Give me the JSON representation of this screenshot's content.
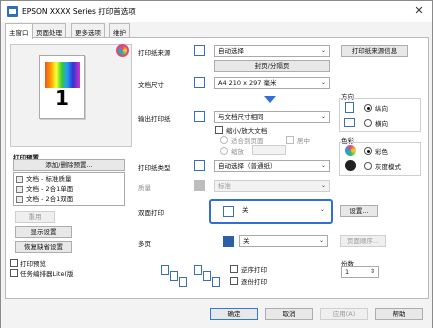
{
  "window": {
    "title": "EPSON XXXX Series 打印首选项",
    "close_glyph": "✕"
  },
  "tabs": [
    {
      "label": "主窗口",
      "active": true
    },
    {
      "label": "页面处理"
    },
    {
      "label": "更多选项"
    },
    {
      "label": "维护"
    }
  ],
  "preview": {
    "page_number": "1"
  },
  "presets": {
    "title": "打印预置",
    "add_remove_label": "添加/删除预置...",
    "items": [
      {
        "label": "文档 - 标准质量"
      },
      {
        "label": "文档 - 2合1单面"
      },
      {
        "label": "文档 - 2合1双面"
      }
    ],
    "show_settings_label": "显示设置",
    "reset_label": "恢复缺省设置",
    "apply_label": "重用",
    "print_preview_label": "打印预览",
    "job_arranger_label": "任务编排器Lite(版"
  },
  "settings": {
    "paper_source_label": "打印纸来源",
    "paper_source_value": "自动选择",
    "paper_source_info_label": "打印纸来源信息",
    "envelope_label": "封页/分隔页",
    "doc_size_label": "文档尺寸",
    "doc_size_value": "A4 210 x 297 毫米",
    "output_paper_label": "输出打印纸",
    "output_paper_value": "与文档尺寸相同",
    "reduce_enlarge_label": "缩小/放大文档",
    "fit_to_page_label": "适合到页面",
    "center_label": "居中",
    "zoom_label": "缩放",
    "paper_type_label": "打印纸类型",
    "paper_type_value": "自动选择（普通纸）",
    "quality_label": "质量",
    "quality_value": "标准",
    "duplex_label": "双面打印",
    "duplex_value": "关",
    "duplex_settings_label": "设置...",
    "multipage_label": "多页",
    "multipage_value": "关",
    "page_order_label": "页面顺序...",
    "reverse_label": "逆序打印",
    "collate_label": "逐份打印",
    "copies_label": "份数",
    "copies_value": "1"
  },
  "orientation": {
    "title": "方向",
    "portrait_label": "纵向",
    "landscape_label": "横向"
  },
  "color": {
    "title": "色彩",
    "color_label": "彩色",
    "grayscale_label": "灰度模式"
  },
  "buttons": {
    "ok": "确定",
    "cancel": "取消",
    "apply": "应用(A)",
    "help": "帮助"
  },
  "colors": {
    "accent": "#2f6fd6",
    "selected_item_bg": "#cde3f7"
  }
}
